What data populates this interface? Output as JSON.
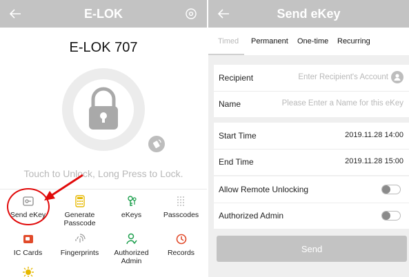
{
  "left": {
    "title": "E-LOK",
    "lock_name": "E-LOK 707",
    "hint": "Touch to Unlock, Long Press to Lock.",
    "icons": {
      "back": "back-arrow-icon",
      "settings": "settings-icon",
      "lock": "padlock-icon",
      "badge": "remote-icon"
    },
    "grid": [
      {
        "label": "Send eKey",
        "icon": "ekey-card-icon",
        "color": "#8a8a8a"
      },
      {
        "label": "Generate Passcode",
        "icon": "keypad-icon",
        "color": "#e6b800"
      },
      {
        "label": "eKeys",
        "icon": "ekeys-icon",
        "color": "#1a9e4b"
      },
      {
        "label": "Passcodes",
        "icon": "passcodes-icon",
        "color": "#9a9a9a"
      },
      {
        "label": "IC Cards",
        "icon": "ic-card-icon",
        "color": "#e14a2a"
      },
      {
        "label": "Fingerprints",
        "icon": "fingerprint-icon",
        "color": "#9a9a9a"
      },
      {
        "label": "Authorized Admin",
        "icon": "admin-icon",
        "color": "#1a9e4b"
      },
      {
        "label": "Records",
        "icon": "records-icon",
        "color": "#e14a2a"
      },
      {
        "label": "",
        "icon": "settings-sun-icon",
        "color": "#e6b800"
      }
    ],
    "highlight_color": "#e10a0a"
  },
  "right": {
    "title": "Send eKey",
    "tabs": [
      "Timed",
      "Permanent",
      "One-time",
      "Recurring"
    ],
    "active_tab": "Timed",
    "recipient": {
      "label": "Recipient",
      "placeholder": "Enter Recipient's Account"
    },
    "name": {
      "label": "Name",
      "placeholder": "Please Enter a Name for this eKey"
    },
    "start_time": {
      "label": "Start Time",
      "value": "2019.11.28 14:00"
    },
    "end_time": {
      "label": "End Time",
      "value": "2019.11.28 15:00"
    },
    "remote_unlock": {
      "label": "Allow Remote Unlocking",
      "on": false
    },
    "authorized_admin": {
      "label": "Authorized Admin",
      "on": false
    },
    "send_label": "Send"
  },
  "colors": {
    "topbar": "#c3c3c3",
    "background": "#efefef",
    "placeholder": "#b8b8b8"
  }
}
